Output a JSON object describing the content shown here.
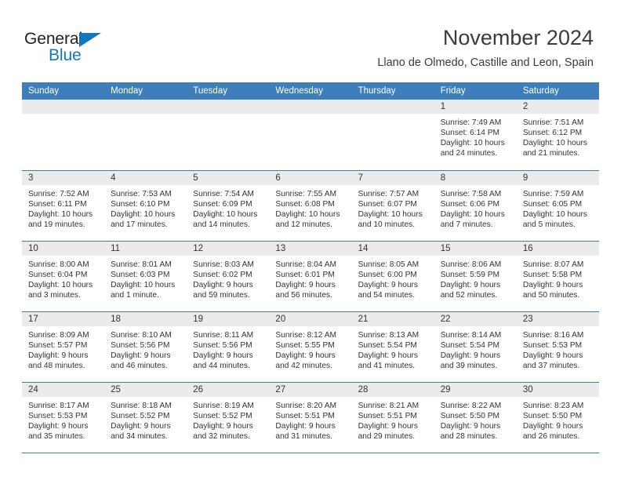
{
  "brand": {
    "name_top": "General",
    "name_bottom": "Blue",
    "triangle_icon": "triangle-icon",
    "color_dark": "#231f20",
    "color_blue": "#1277bd"
  },
  "header": {
    "month_title": "November 2024",
    "location": "Llano de Olmedo, Castille and Leon, Spain"
  },
  "theme": {
    "accent": "#3d7ebb",
    "daynum_band": "#ebebeb",
    "text": "#333333"
  },
  "calendar": {
    "weekday_headers": [
      "Sunday",
      "Monday",
      "Tuesday",
      "Wednesday",
      "Thursday",
      "Friday",
      "Saturday"
    ],
    "labels": {
      "sunrise": "Sunrise:",
      "sunset": "Sunset:",
      "daylight": "Daylight:"
    },
    "weeks": [
      [
        {
          "day": "",
          "empty": true
        },
        {
          "day": "",
          "empty": true
        },
        {
          "day": "",
          "empty": true
        },
        {
          "day": "",
          "empty": true
        },
        {
          "day": "",
          "empty": true
        },
        {
          "day": "1",
          "sunrise": "Sunrise: 7:49 AM",
          "sunset": "Sunset: 6:14 PM",
          "daylight": "Daylight: 10 hours and 24 minutes."
        },
        {
          "day": "2",
          "sunrise": "Sunrise: 7:51 AM",
          "sunset": "Sunset: 6:12 PM",
          "daylight": "Daylight: 10 hours and 21 minutes."
        }
      ],
      [
        {
          "day": "3",
          "sunrise": "Sunrise: 7:52 AM",
          "sunset": "Sunset: 6:11 PM",
          "daylight": "Daylight: 10 hours and 19 minutes."
        },
        {
          "day": "4",
          "sunrise": "Sunrise: 7:53 AM",
          "sunset": "Sunset: 6:10 PM",
          "daylight": "Daylight: 10 hours and 17 minutes."
        },
        {
          "day": "5",
          "sunrise": "Sunrise: 7:54 AM",
          "sunset": "Sunset: 6:09 PM",
          "daylight": "Daylight: 10 hours and 14 minutes."
        },
        {
          "day": "6",
          "sunrise": "Sunrise: 7:55 AM",
          "sunset": "Sunset: 6:08 PM",
          "daylight": "Daylight: 10 hours and 12 minutes."
        },
        {
          "day": "7",
          "sunrise": "Sunrise: 7:57 AM",
          "sunset": "Sunset: 6:07 PM",
          "daylight": "Daylight: 10 hours and 10 minutes."
        },
        {
          "day": "8",
          "sunrise": "Sunrise: 7:58 AM",
          "sunset": "Sunset: 6:06 PM",
          "daylight": "Daylight: 10 hours and 7 minutes."
        },
        {
          "day": "9",
          "sunrise": "Sunrise: 7:59 AM",
          "sunset": "Sunset: 6:05 PM",
          "daylight": "Daylight: 10 hours and 5 minutes."
        }
      ],
      [
        {
          "day": "10",
          "sunrise": "Sunrise: 8:00 AM",
          "sunset": "Sunset: 6:04 PM",
          "daylight": "Daylight: 10 hours and 3 minutes."
        },
        {
          "day": "11",
          "sunrise": "Sunrise: 8:01 AM",
          "sunset": "Sunset: 6:03 PM",
          "daylight": "Daylight: 10 hours and 1 minute."
        },
        {
          "day": "12",
          "sunrise": "Sunrise: 8:03 AM",
          "sunset": "Sunset: 6:02 PM",
          "daylight": "Daylight: 9 hours and 59 minutes."
        },
        {
          "day": "13",
          "sunrise": "Sunrise: 8:04 AM",
          "sunset": "Sunset: 6:01 PM",
          "daylight": "Daylight: 9 hours and 56 minutes."
        },
        {
          "day": "14",
          "sunrise": "Sunrise: 8:05 AM",
          "sunset": "Sunset: 6:00 PM",
          "daylight": "Daylight: 9 hours and 54 minutes."
        },
        {
          "day": "15",
          "sunrise": "Sunrise: 8:06 AM",
          "sunset": "Sunset: 5:59 PM",
          "daylight": "Daylight: 9 hours and 52 minutes."
        },
        {
          "day": "16",
          "sunrise": "Sunrise: 8:07 AM",
          "sunset": "Sunset: 5:58 PM",
          "daylight": "Daylight: 9 hours and 50 minutes."
        }
      ],
      [
        {
          "day": "17",
          "sunrise": "Sunrise: 8:09 AM",
          "sunset": "Sunset: 5:57 PM",
          "daylight": "Daylight: 9 hours and 48 minutes."
        },
        {
          "day": "18",
          "sunrise": "Sunrise: 8:10 AM",
          "sunset": "Sunset: 5:56 PM",
          "daylight": "Daylight: 9 hours and 46 minutes."
        },
        {
          "day": "19",
          "sunrise": "Sunrise: 8:11 AM",
          "sunset": "Sunset: 5:56 PM",
          "daylight": "Daylight: 9 hours and 44 minutes."
        },
        {
          "day": "20",
          "sunrise": "Sunrise: 8:12 AM",
          "sunset": "Sunset: 5:55 PM",
          "daylight": "Daylight: 9 hours and 42 minutes."
        },
        {
          "day": "21",
          "sunrise": "Sunrise: 8:13 AM",
          "sunset": "Sunset: 5:54 PM",
          "daylight": "Daylight: 9 hours and 41 minutes."
        },
        {
          "day": "22",
          "sunrise": "Sunrise: 8:14 AM",
          "sunset": "Sunset: 5:54 PM",
          "daylight": "Daylight: 9 hours and 39 minutes."
        },
        {
          "day": "23",
          "sunrise": "Sunrise: 8:16 AM",
          "sunset": "Sunset: 5:53 PM",
          "daylight": "Daylight: 9 hours and 37 minutes."
        }
      ],
      [
        {
          "day": "24",
          "sunrise": "Sunrise: 8:17 AM",
          "sunset": "Sunset: 5:53 PM",
          "daylight": "Daylight: 9 hours and 35 minutes."
        },
        {
          "day": "25",
          "sunrise": "Sunrise: 8:18 AM",
          "sunset": "Sunset: 5:52 PM",
          "daylight": "Daylight: 9 hours and 34 minutes."
        },
        {
          "day": "26",
          "sunrise": "Sunrise: 8:19 AM",
          "sunset": "Sunset: 5:52 PM",
          "daylight": "Daylight: 9 hours and 32 minutes."
        },
        {
          "day": "27",
          "sunrise": "Sunrise: 8:20 AM",
          "sunset": "Sunset: 5:51 PM",
          "daylight": "Daylight: 9 hours and 31 minutes."
        },
        {
          "day": "28",
          "sunrise": "Sunrise: 8:21 AM",
          "sunset": "Sunset: 5:51 PM",
          "daylight": "Daylight: 9 hours and 29 minutes."
        },
        {
          "day": "29",
          "sunrise": "Sunrise: 8:22 AM",
          "sunset": "Sunset: 5:50 PM",
          "daylight": "Daylight: 9 hours and 28 minutes."
        },
        {
          "day": "30",
          "sunrise": "Sunrise: 8:23 AM",
          "sunset": "Sunset: 5:50 PM",
          "daylight": "Daylight: 9 hours and 26 minutes."
        }
      ]
    ]
  }
}
